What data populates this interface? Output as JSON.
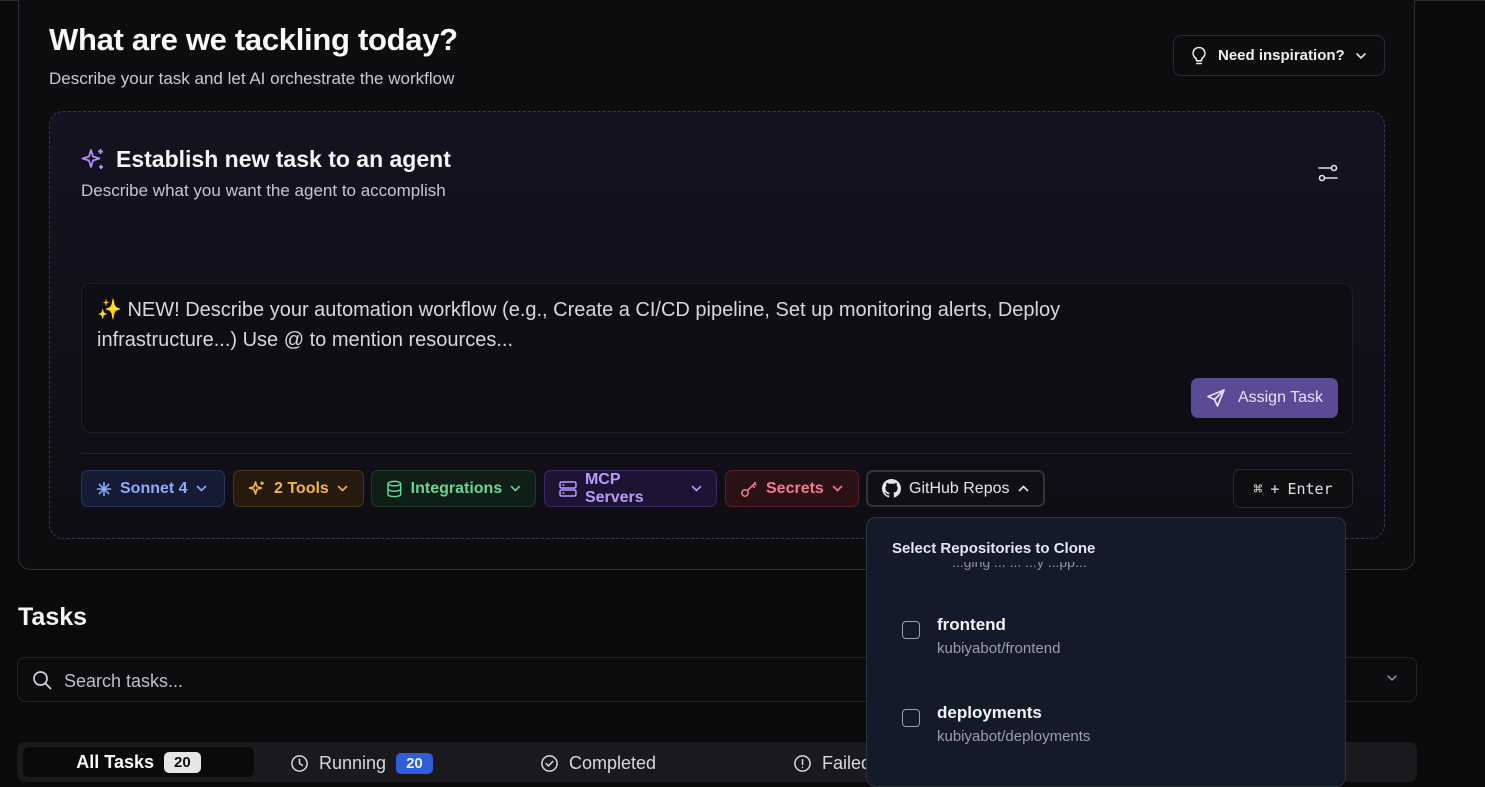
{
  "hero": {
    "title": "What are we tackling today?",
    "subtitle": "Describe your task and let AI orchestrate the workflow",
    "inspiration_label": "Need inspiration?"
  },
  "task_card": {
    "title": "Establish new task to an agent",
    "subtitle": "Describe what you want the agent to accomplish",
    "prompt_placeholder": "✨ NEW! Describe your automation workflow (e.g., Create a CI/CD pipeline, Set up monitoring alerts, Deploy infrastructure...) Use @ to mention resources...",
    "assign_label": "Assign Task"
  },
  "toolbar": {
    "model_label": "Sonnet 4",
    "tools_label": "2 Tools",
    "integrations_label": "Integrations",
    "mcp_label": "MCP Servers",
    "secrets_label": "Secrets",
    "github_label": "GitHub Repos",
    "shortcut_key": "⌘",
    "shortcut_plus": "+",
    "shortcut_enter": "Enter"
  },
  "repo_dropdown": {
    "title": "Select Repositories to Clone",
    "clipped_text": "...ging ... ... ...y ...pp...",
    "repos": [
      {
        "name": "frontend",
        "path": "kubiyabot/frontend",
        "checked": false
      },
      {
        "name": "deployments",
        "path": "kubiyabot/deployments",
        "checked": false
      }
    ]
  },
  "tasks": {
    "heading": "Tasks",
    "search_placeholder": "Search tasks...",
    "tabs": [
      {
        "label": "All Tasks",
        "count": "20"
      },
      {
        "label": "Running",
        "count": "20"
      },
      {
        "label": "Completed"
      },
      {
        "label": "Failed"
      }
    ]
  },
  "colors": {
    "accent_purple": "#5b4a94",
    "running_badge": "#2f5ed8"
  }
}
